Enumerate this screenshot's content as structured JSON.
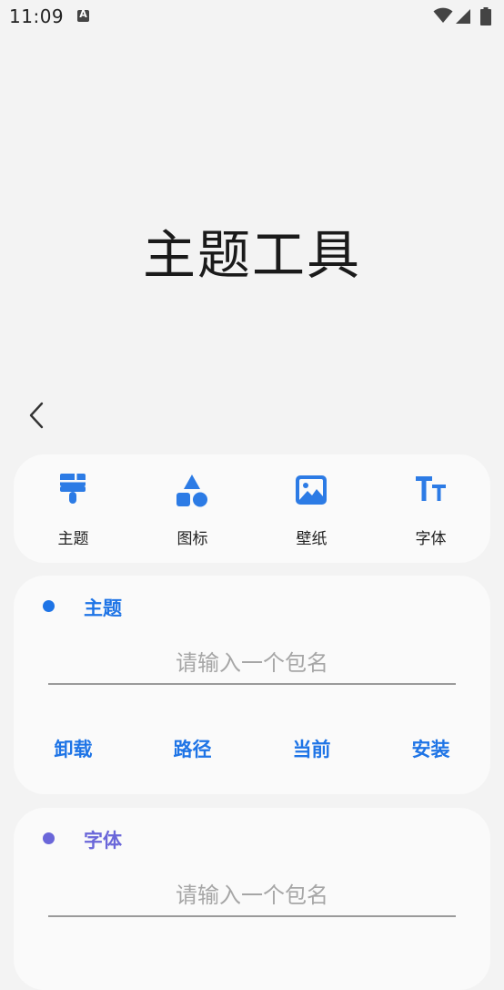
{
  "status_bar": {
    "time": "11:09",
    "notification_letter": "A"
  },
  "page": {
    "title": "主题工具"
  },
  "nav": {
    "items": [
      {
        "label": "主题",
        "icon": "paint-brush-icon"
      },
      {
        "label": "图标",
        "icon": "shapes-icon"
      },
      {
        "label": "壁纸",
        "icon": "image-icon"
      },
      {
        "label": "字体",
        "icon": "font-icon"
      }
    ]
  },
  "sections": {
    "theme": {
      "title": "主题",
      "placeholder": "请输入一个包名",
      "value": "",
      "actions": [
        "卸载",
        "路径",
        "当前",
        "安装"
      ]
    },
    "font": {
      "title": "字体",
      "placeholder": "请输入一个包名",
      "value": ""
    }
  },
  "colors": {
    "accent": "#1e74e6",
    "icon_blue": "#2c7be5",
    "font_section": "#6a66d9",
    "background": "#f3f3f3",
    "card": "#fafafa"
  }
}
